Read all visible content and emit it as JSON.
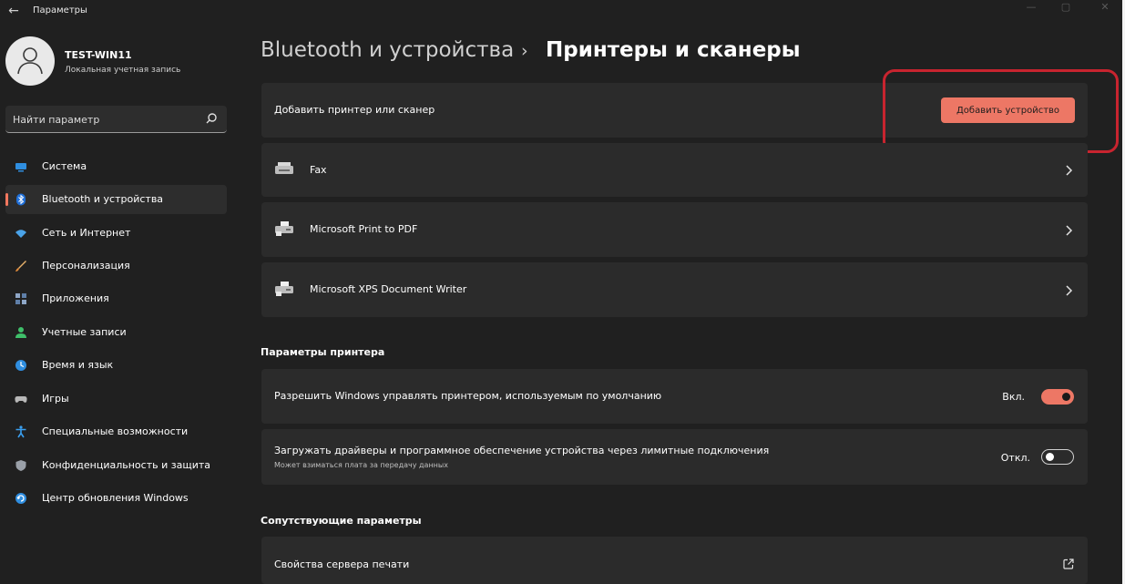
{
  "window": {
    "title": "Параметры",
    "controls": {
      "minimize": "—",
      "maximize": "▢",
      "close": "✕"
    }
  },
  "profile": {
    "name": "TEST-WIN11",
    "account_type": "Локальная учетная запись"
  },
  "search": {
    "placeholder": "Найти параметр"
  },
  "sidebar": {
    "items": [
      {
        "label": "Система",
        "icon": "system-icon",
        "color": "#2f8ee0"
      },
      {
        "label": "Bluetooth и устройства",
        "icon": "bluetooth-icon",
        "color": "#1f6fd8",
        "selected": true
      },
      {
        "label": "Сеть и Интернет",
        "icon": "network-icon",
        "color": "#4aa3e8"
      },
      {
        "label": "Персонализация",
        "icon": "brush-icon",
        "color": "#e0a15a"
      },
      {
        "label": "Приложения",
        "icon": "apps-icon",
        "color": "#8ea6c6"
      },
      {
        "label": "Учетные записи",
        "icon": "accounts-icon",
        "color": "#3fbf6a"
      },
      {
        "label": "Время и язык",
        "icon": "time-language-icon",
        "color": "#2f8ee0"
      },
      {
        "label": "Игры",
        "icon": "gaming-icon",
        "color": "#b8b8b8"
      },
      {
        "label": "Специальные возможности",
        "icon": "accessibility-icon",
        "color": "#3a9ff0"
      },
      {
        "label": "Конфиденциальность и защита",
        "icon": "shield-icon",
        "color": "#9aa0a8"
      },
      {
        "label": "Центр обновления Windows",
        "icon": "update-icon",
        "color": "#2f8ee0"
      }
    ]
  },
  "breadcrumb": {
    "parent": "Bluetooth и устройства",
    "separator": "›",
    "current": "Принтеры и сканеры"
  },
  "add_device": {
    "label": "Добавить принтер или сканер",
    "button": "Добавить устройство"
  },
  "printers": [
    {
      "name": "Fax",
      "icon": "fax-icon"
    },
    {
      "name": "Microsoft Print to PDF",
      "icon": "printer-icon"
    },
    {
      "name": "Microsoft XPS Document Writer",
      "icon": "printer-icon"
    }
  ],
  "printer_settings": {
    "title": "Параметры принтера",
    "default_printer": {
      "label": "Разрешить Windows управлять принтером, используемым по умолчанию",
      "state_label": "Вкл.",
      "on": true
    },
    "metered": {
      "label": "Загружать драйверы и программное обеспечение устройства через лимитные подключения",
      "sublabel": "Может взиматься плата за передачу данных",
      "state_label": "Откл.",
      "on": false
    }
  },
  "related": {
    "title": "Сопутствующие параметры",
    "print_server": {
      "label": "Свойства сервера печати",
      "icon": "open-external-icon"
    }
  },
  "colors": {
    "accent": "#ed7765",
    "highlight": "#c8242f",
    "background": "#202020",
    "card": "#2b2b2b"
  }
}
